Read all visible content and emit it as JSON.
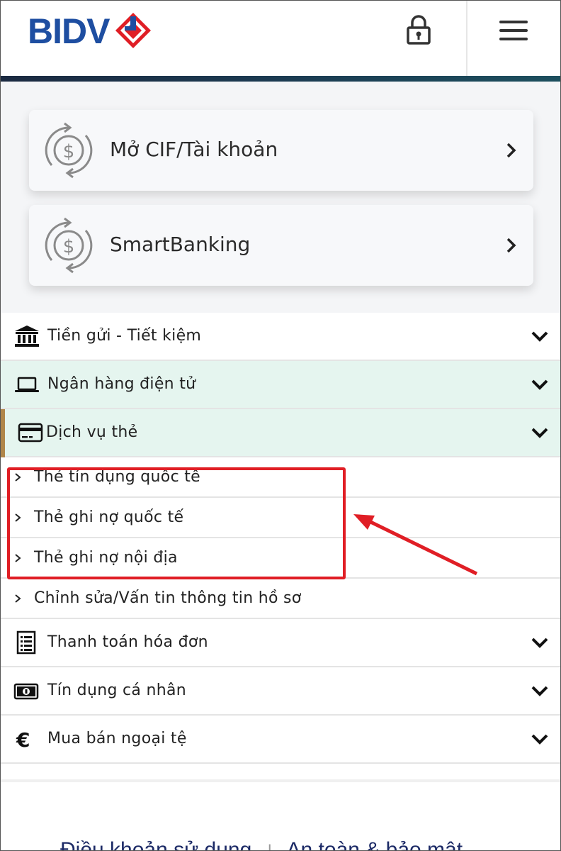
{
  "header": {
    "logo_text": "BIDV",
    "lock_icon": "lock-icon",
    "menu_icon": "hamburger-menu-icon",
    "colors": {
      "brand_blue": "#1e4ea1",
      "brand_red": "#e01e25",
      "bar": "#1b2a41"
    }
  },
  "cards": [
    {
      "label": "Mở CIF/Tài khoản",
      "icon": "dollar-refresh-icon"
    },
    {
      "label": "SmartBanking",
      "icon": "dollar-refresh-icon"
    }
  ],
  "menu": {
    "items": [
      {
        "label": "Tiền gửi - Tiết kiệm",
        "icon": "bank-icon",
        "expanded": false
      },
      {
        "label": "Ngân hàng điện tử",
        "icon": "laptop-icon",
        "expanded": true
      },
      {
        "label": "Dịch vụ thẻ",
        "icon": "credit-card-icon",
        "expanded": true,
        "active": true
      }
    ],
    "card_subitems": [
      {
        "label": "Thẻ tín dụng quốc tế"
      },
      {
        "label": "Thẻ ghi nợ quốc tế"
      },
      {
        "label": "Thẻ ghi nợ nội địa"
      },
      {
        "label": "Chỉnh sửa/Vấn tin thông tin hồ sơ"
      }
    ],
    "items_after": [
      {
        "label": "Thanh toán hóa đơn",
        "icon": "invoice-icon"
      },
      {
        "label": "Tín dụng cá nhân",
        "icon": "money-bill-icon"
      },
      {
        "label": "Mua bán ngoại tệ",
        "icon": "euro-icon"
      }
    ]
  },
  "footer": {
    "link_terms": "Điều khoản sử dụng",
    "link_security": "An toàn & bảo mật",
    "separator": "|"
  },
  "annotation": {
    "highlight_color": "#e01e25"
  }
}
